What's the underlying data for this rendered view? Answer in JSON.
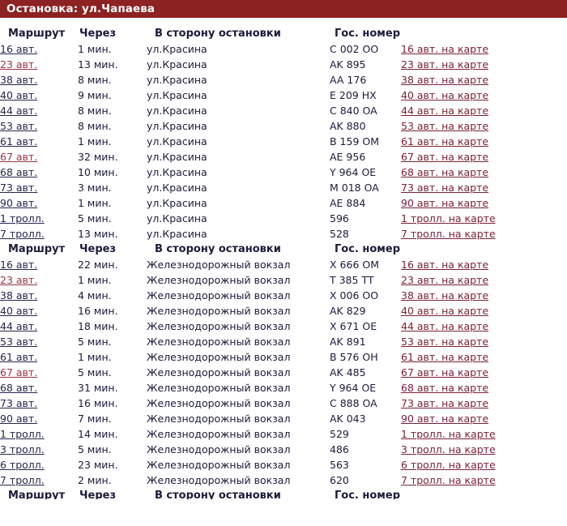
{
  "titlebar": {
    "title": "Остановка: ул.Чапаева",
    "bg_color": "#8c2222",
    "text_color": "#ffffff"
  },
  "colors": {
    "accent": "#8c2222",
    "link": "#26264f",
    "link_visited": "#9c3344",
    "map_link": "#7b2233",
    "text": "#1b1b3c"
  },
  "columns": {
    "route": "Маршрут",
    "in": "Через",
    "direction": "В сторону остановки",
    "plate": "Гос. номер",
    "map": ""
  },
  "tables": [
    {
      "direction_name": "ул.Красина",
      "rows": [
        {
          "route": "16 авт.",
          "in": "1 мин.",
          "direction": "ул.Красина",
          "plate": "C 002 OO",
          "map": "16 авт. на карте",
          "visited": false
        },
        {
          "route": "23 авт.",
          "in": "13 мин.",
          "direction": "ул.Красина",
          "plate": "AK 895",
          "map": "23 авт. на карте",
          "visited": true
        },
        {
          "route": "38 авт.",
          "in": "8 мин.",
          "direction": "ул.Красина",
          "plate": "AA 176",
          "map": "38 авт. на карте",
          "visited": false
        },
        {
          "route": "40 авт.",
          "in": "9 мин.",
          "direction": "ул.Красина",
          "plate": "E 209 HX",
          "map": "40 авт. на карте",
          "visited": false
        },
        {
          "route": "44 авт.",
          "in": "8 мин.",
          "direction": "ул.Красина",
          "plate": "C 840 OA",
          "map": "44 авт. на карте",
          "visited": false
        },
        {
          "route": "53 авт.",
          "in": "8 мин.",
          "direction": "ул.Красина",
          "plate": "AK 880",
          "map": "53 авт. на карте",
          "visited": false
        },
        {
          "route": "61 авт.",
          "in": "1 мин.",
          "direction": "ул.Красина",
          "plate": "B 159 OM",
          "map": "61 авт. на карте",
          "visited": false
        },
        {
          "route": "67 авт.",
          "in": "32 мин.",
          "direction": "ул.Красина",
          "plate": "AE 956",
          "map": "67 авт. на карте",
          "visited": true
        },
        {
          "route": "68 авт.",
          "in": "10 мин.",
          "direction": "ул.Красина",
          "plate": "Y 964 OE",
          "map": "68 авт. на карте",
          "visited": false
        },
        {
          "route": "73 авт.",
          "in": "3 мин.",
          "direction": "ул.Красина",
          "plate": "M 018 OA",
          "map": "73 авт. на карте",
          "visited": false
        },
        {
          "route": "90 авт.",
          "in": "1 мин.",
          "direction": "ул.Красина",
          "plate": "AE 884",
          "map": "90 авт. на карте",
          "visited": false
        },
        {
          "route": "1 тролл.",
          "in": "5 мин.",
          "direction": "ул.Красина",
          "plate": "596",
          "map": "1 тролл. на карте",
          "visited": false
        },
        {
          "route": "7 тролл.",
          "in": "13 мин.",
          "direction": "ул.Красина",
          "plate": "528",
          "map": "7 тролл. на карте",
          "visited": false
        }
      ]
    },
    {
      "direction_name": "Железнодорожный вокзал",
      "rows": [
        {
          "route": "16 авт.",
          "in": "22 мин.",
          "direction": "Железнодорожный вокзал",
          "plate": "X 666 OM",
          "map": "16 авт. на карте",
          "visited": false
        },
        {
          "route": "23 авт.",
          "in": "1 мин.",
          "direction": "Железнодорожный вокзал",
          "plate": "T 385 TT",
          "map": "23 авт. на карте",
          "visited": true
        },
        {
          "route": "38 авт.",
          "in": "4 мин.",
          "direction": "Железнодорожный вокзал",
          "plate": "X 006 OO",
          "map": "38 авт. на карте",
          "visited": false
        },
        {
          "route": "40 авт.",
          "in": "16 мин.",
          "direction": "Железнодорожный вокзал",
          "plate": "AK 829",
          "map": "40 авт. на карте",
          "visited": false
        },
        {
          "route": "44 авт.",
          "in": "18 мин.",
          "direction": "Железнодорожный вокзал",
          "plate": "X 671 OE",
          "map": "44 авт. на карте",
          "visited": false
        },
        {
          "route": "53 авт.",
          "in": "5 мин.",
          "direction": "Железнодорожный вокзал",
          "plate": "AK 891",
          "map": "53 авт. на карте",
          "visited": false
        },
        {
          "route": "61 авт.",
          "in": "1 мин.",
          "direction": "Железнодорожный вокзал",
          "plate": "B 576 OH",
          "map": "61 авт. на карте",
          "visited": false
        },
        {
          "route": "67 авт.",
          "in": "5 мин.",
          "direction": "Железнодорожный вокзал",
          "plate": "AK 485",
          "map": "67 авт. на карте",
          "visited": true
        },
        {
          "route": "68 авт.",
          "in": "31 мин.",
          "direction": "Железнодорожный вокзал",
          "plate": "Y 964 OE",
          "map": "68 авт. на карте",
          "visited": false
        },
        {
          "route": "73 авт.",
          "in": "16 мин.",
          "direction": "Железнодорожный вокзал",
          "plate": "C 888 OA",
          "map": "73 авт. на карте",
          "visited": false
        },
        {
          "route": "90 авт.",
          "in": "7 мин.",
          "direction": "Железнодорожный вокзал",
          "plate": "AK 043",
          "map": "90 авт. на карте",
          "visited": false
        },
        {
          "route": "1 тролл.",
          "in": "14 мин.",
          "direction": "Железнодорожный вокзал",
          "plate": "529",
          "map": "1 тролл. на карте",
          "visited": false
        },
        {
          "route": "3 тролл.",
          "in": "5 мин.",
          "direction": "Железнодорожный вокзал",
          "plate": "486",
          "map": "3 тролл. на карте",
          "visited": false
        },
        {
          "route": "6 тролл.",
          "in": "23 мин.",
          "direction": "Железнодорожный вокзал",
          "plate": "563",
          "map": "6 тролл. на карте",
          "visited": false
        },
        {
          "route": "7 тролл.",
          "in": "2 мин.",
          "direction": "Железнодорожный вокзал",
          "plate": "620",
          "map": "7 тролл. на карте",
          "visited": false
        }
      ]
    },
    {
      "direction_name": "",
      "clipped": true,
      "rows": []
    }
  ]
}
